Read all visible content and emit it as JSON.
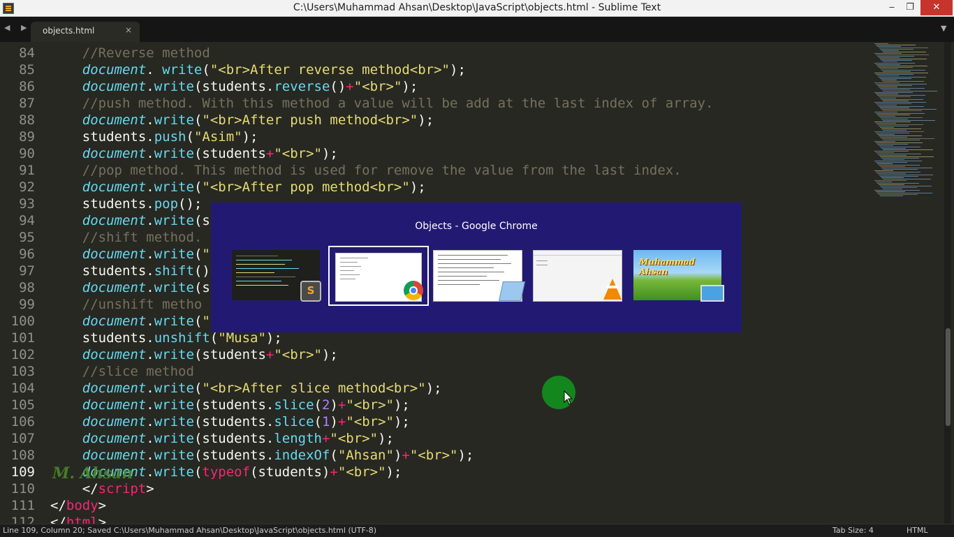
{
  "window": {
    "title": "C:\\Users\\Muhammad Ahsan\\Desktop\\JavaScript\\objects.html - Sublime Text",
    "minimize": "‒",
    "maximize": "❐",
    "close": "✕"
  },
  "tabs": {
    "nav": "◀ ▶",
    "active_label": "objects.html",
    "close": "×",
    "dropdown": "▼"
  },
  "code": {
    "current_line": "109",
    "lines": [
      {
        "n": "84",
        "tokens": [
          [
            "cm",
            "    //Reverse method"
          ]
        ]
      },
      {
        "n": "85",
        "tokens": [
          [
            "",
            "    "
          ],
          [
            "it",
            "document"
          ],
          [
            "",
            ". "
          ],
          [
            "fn",
            "write"
          ],
          [
            "",
            "("
          ],
          [
            "st",
            "\"<br>After reverse method<br>\""
          ],
          [
            "",
            ");"
          ]
        ]
      },
      {
        "n": "86",
        "tokens": [
          [
            "",
            "    "
          ],
          [
            "it",
            "document"
          ],
          [
            "",
            "."
          ],
          [
            "fn",
            "write"
          ],
          [
            "",
            "(students."
          ],
          [
            "fn",
            "reverse"
          ],
          [
            "",
            "()"
          ],
          [
            "op",
            "+"
          ],
          [
            "st",
            "\"<br>\""
          ],
          [
            "",
            ");"
          ]
        ]
      },
      {
        "n": "87",
        "tokens": [
          [
            "cm",
            "    //push method. With this method a value will be add at the last index of array."
          ]
        ]
      },
      {
        "n": "88",
        "tokens": [
          [
            "",
            "    "
          ],
          [
            "it",
            "document"
          ],
          [
            "",
            "."
          ],
          [
            "fn",
            "write"
          ],
          [
            "",
            "("
          ],
          [
            "st",
            "\"<br>After push method<br>\""
          ],
          [
            "",
            ");"
          ]
        ]
      },
      {
        "n": "89",
        "tokens": [
          [
            "",
            "    students."
          ],
          [
            "fn",
            "push"
          ],
          [
            "",
            "("
          ],
          [
            "st",
            "\"Asim\""
          ],
          [
            "",
            ");"
          ]
        ]
      },
      {
        "n": "90",
        "tokens": [
          [
            "",
            "    "
          ],
          [
            "it",
            "document"
          ],
          [
            "",
            "."
          ],
          [
            "fn",
            "write"
          ],
          [
            "",
            "(students"
          ],
          [
            "op",
            "+"
          ],
          [
            "st",
            "\"<br>\""
          ],
          [
            "",
            ");"
          ]
        ]
      },
      {
        "n": "91",
        "tokens": [
          [
            "cm",
            "    //pop method. This method is used for remove the value from the last index."
          ]
        ]
      },
      {
        "n": "92",
        "tokens": [
          [
            "",
            "    "
          ],
          [
            "it",
            "document"
          ],
          [
            "",
            "."
          ],
          [
            "fn",
            "write"
          ],
          [
            "",
            "("
          ],
          [
            "st",
            "\"<br>After pop method<br>\""
          ],
          [
            "",
            ");"
          ]
        ]
      },
      {
        "n": "93",
        "tokens": [
          [
            "",
            "    students."
          ],
          [
            "fn",
            "pop"
          ],
          [
            "",
            "();"
          ]
        ]
      },
      {
        "n": "94",
        "tokens": [
          [
            "",
            "    "
          ],
          [
            "it",
            "document"
          ],
          [
            "",
            "."
          ],
          [
            "fn",
            "write"
          ],
          [
            "",
            "(s"
          ]
        ]
      },
      {
        "n": "95",
        "tokens": [
          [
            "cm",
            "    //shift method."
          ]
        ]
      },
      {
        "n": "96",
        "tokens": [
          [
            "",
            "    "
          ],
          [
            "it",
            "document"
          ],
          [
            "",
            "."
          ],
          [
            "fn",
            "write"
          ],
          [
            "",
            "("
          ],
          [
            "st",
            "\""
          ]
        ]
      },
      {
        "n": "97",
        "tokens": [
          [
            "",
            "    students."
          ],
          [
            "fn",
            "shift"
          ],
          [
            "",
            "()"
          ]
        ]
      },
      {
        "n": "98",
        "tokens": [
          [
            "",
            "    "
          ],
          [
            "it",
            "document"
          ],
          [
            "",
            "."
          ],
          [
            "fn",
            "write"
          ],
          [
            "",
            "(s"
          ]
        ]
      },
      {
        "n": "99",
        "tokens": [
          [
            "cm",
            "    //unshift metho"
          ]
        ]
      },
      {
        "n": "100",
        "tokens": [
          [
            "",
            "    "
          ],
          [
            "it",
            "document"
          ],
          [
            "",
            "."
          ],
          [
            "fn",
            "write"
          ],
          [
            "",
            "("
          ],
          [
            "st",
            "\""
          ]
        ]
      },
      {
        "n": "101",
        "tokens": [
          [
            "",
            "    students."
          ],
          [
            "fn",
            "unshift"
          ],
          [
            "",
            "("
          ],
          [
            "st",
            "\"Musa\""
          ],
          [
            "",
            ");"
          ]
        ]
      },
      {
        "n": "102",
        "tokens": [
          [
            "",
            "    "
          ],
          [
            "it",
            "document"
          ],
          [
            "",
            "."
          ],
          [
            "fn",
            "write"
          ],
          [
            "",
            "(students"
          ],
          [
            "op",
            "+"
          ],
          [
            "st",
            "\"<br>\""
          ],
          [
            "",
            ");"
          ]
        ]
      },
      {
        "n": "103",
        "tokens": [
          [
            "cm",
            "    //slice method"
          ]
        ]
      },
      {
        "n": "104",
        "tokens": [
          [
            "",
            "    "
          ],
          [
            "it",
            "document"
          ],
          [
            "",
            "."
          ],
          [
            "fn",
            "write"
          ],
          [
            "",
            "("
          ],
          [
            "st",
            "\"<br>After slice method<br>\""
          ],
          [
            "",
            ");"
          ]
        ]
      },
      {
        "n": "105",
        "tokens": [
          [
            "",
            "    "
          ],
          [
            "it",
            "document"
          ],
          [
            "",
            "."
          ],
          [
            "fn",
            "write"
          ],
          [
            "",
            "(students."
          ],
          [
            "fn",
            "slice"
          ],
          [
            "",
            "("
          ],
          [
            "num",
            "2"
          ],
          [
            "",
            ")"
          ],
          [
            "op",
            "+"
          ],
          [
            "st",
            "\"<br>\""
          ],
          [
            "",
            ");"
          ]
        ]
      },
      {
        "n": "106",
        "tokens": [
          [
            "",
            "    "
          ],
          [
            "it",
            "document"
          ],
          [
            "",
            "."
          ],
          [
            "fn",
            "write"
          ],
          [
            "",
            "(students."
          ],
          [
            "fn",
            "slice"
          ],
          [
            "",
            "("
          ],
          [
            "num",
            "1"
          ],
          [
            "",
            ")"
          ],
          [
            "op",
            "+"
          ],
          [
            "st",
            "\"<br>\""
          ],
          [
            "",
            ");"
          ]
        ]
      },
      {
        "n": "107",
        "tokens": [
          [
            "",
            "    "
          ],
          [
            "it",
            "document"
          ],
          [
            "",
            "."
          ],
          [
            "fn",
            "write"
          ],
          [
            "",
            "(students."
          ],
          [
            "fn",
            "length"
          ],
          [
            "op",
            "+"
          ],
          [
            "st",
            "\"<br>\""
          ],
          [
            "",
            ");"
          ]
        ]
      },
      {
        "n": "108",
        "tokens": [
          [
            "",
            "    "
          ],
          [
            "it",
            "document"
          ],
          [
            "",
            "."
          ],
          [
            "fn",
            "write"
          ],
          [
            "",
            "(students."
          ],
          [
            "fn",
            "indexOf"
          ],
          [
            "",
            "("
          ],
          [
            "st",
            "\"Ahsan\""
          ],
          [
            "",
            ")"
          ],
          [
            "op",
            "+"
          ],
          [
            "st",
            "\"<br>\""
          ],
          [
            "",
            ");"
          ]
        ]
      },
      {
        "n": "109",
        "tokens": [
          [
            "",
            "    "
          ],
          [
            "it",
            "document"
          ],
          [
            "",
            "."
          ],
          [
            "fn",
            "write"
          ],
          [
            "",
            "("
          ],
          [
            "ks",
            "typeof"
          ],
          [
            "",
            "(students)"
          ],
          [
            "op",
            "+"
          ],
          [
            "st",
            "\"<br>\""
          ],
          [
            "",
            ");"
          ]
        ]
      },
      {
        "n": "110",
        "tokens": [
          [
            "",
            "    </"
          ],
          [
            "tg",
            "script"
          ],
          [
            "",
            ">"
          ]
        ]
      },
      {
        "n": "111",
        "tokens": [
          [
            "",
            "</"
          ],
          [
            "tg",
            "body"
          ],
          [
            "",
            ">"
          ]
        ]
      },
      {
        "n": "112",
        "tokens": [
          [
            "",
            "</"
          ],
          [
            "tg",
            "html"
          ],
          [
            "",
            ">"
          ]
        ]
      }
    ]
  },
  "watermark": "M. Ahsan",
  "switcher": {
    "title": "Objects - Google Chrome",
    "badge_sublime": "S",
    "thumb5_text": "Muhammad Ahsan"
  },
  "status": {
    "left": "Line 109, Column 20; Saved C:\\Users\\Muhammad Ahsan\\Desktop\\JavaScript\\objects.html (UTF-8)",
    "tab_size": "Tab Size: 4",
    "syntax": "HTML"
  },
  "colors": {
    "background": "#272822",
    "comment": "#75715e",
    "string": "#e6db74",
    "keyword": "#f92672",
    "function": "#66d9ef",
    "number": "#ae81ff",
    "switcher_bg": "#221a72"
  }
}
